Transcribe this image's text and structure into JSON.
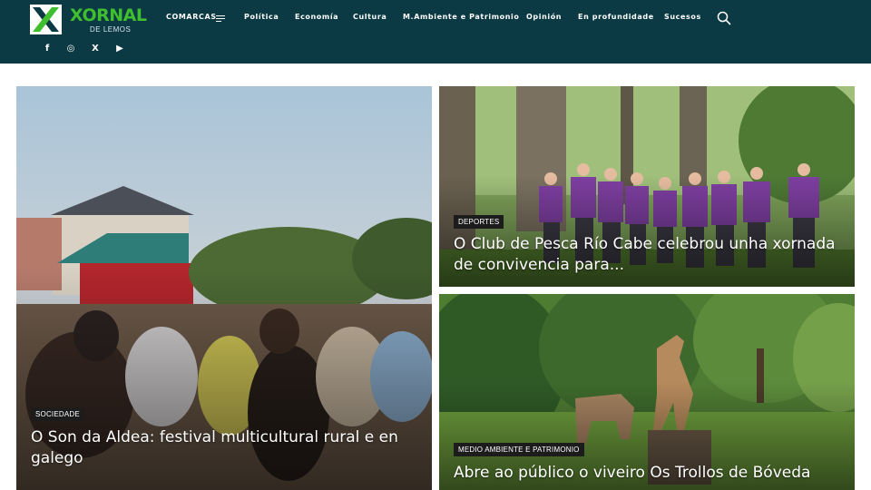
{
  "header": {
    "logo": {
      "title": "XORNAL",
      "subtitle": "DE LEMOS"
    },
    "nav": [
      {
        "label": "COMARCAS",
        "has_menu": true
      },
      {
        "label": "Política"
      },
      {
        "label": "Economía"
      },
      {
        "label": "Cultura"
      },
      {
        "label": "M.Ambiente e Patrimonio"
      },
      {
        "label": "Opinión"
      },
      {
        "label": "En profundidade"
      },
      {
        "label": "Sucesos"
      }
    ],
    "search_icon": "search-icon",
    "social": [
      {
        "icon": "facebook-icon",
        "glyph": "f"
      },
      {
        "icon": "instagram-icon",
        "glyph": "◎"
      },
      {
        "icon": "x-icon",
        "glyph": "X"
      },
      {
        "icon": "youtube-icon",
        "glyph": "▶"
      }
    ]
  },
  "articles": [
    {
      "category": "SOCIEDADE",
      "title": "O Son da Aldea: festival multicultural rural e en galego"
    },
    {
      "category": "DEPORTES",
      "title": "O Club de Pesca Río Cabe celebrou unha xornada de convivencia para..."
    },
    {
      "category": "MEDIO AMBIENTE E PATRIMONIO",
      "title": "Abre ao público o viveiro Os Trollos de Bóveda"
    }
  ],
  "colors": {
    "header_bg": "#0b3a44",
    "logo_green": "#3fbf2f",
    "badge_bg": "#1c1c1c"
  }
}
